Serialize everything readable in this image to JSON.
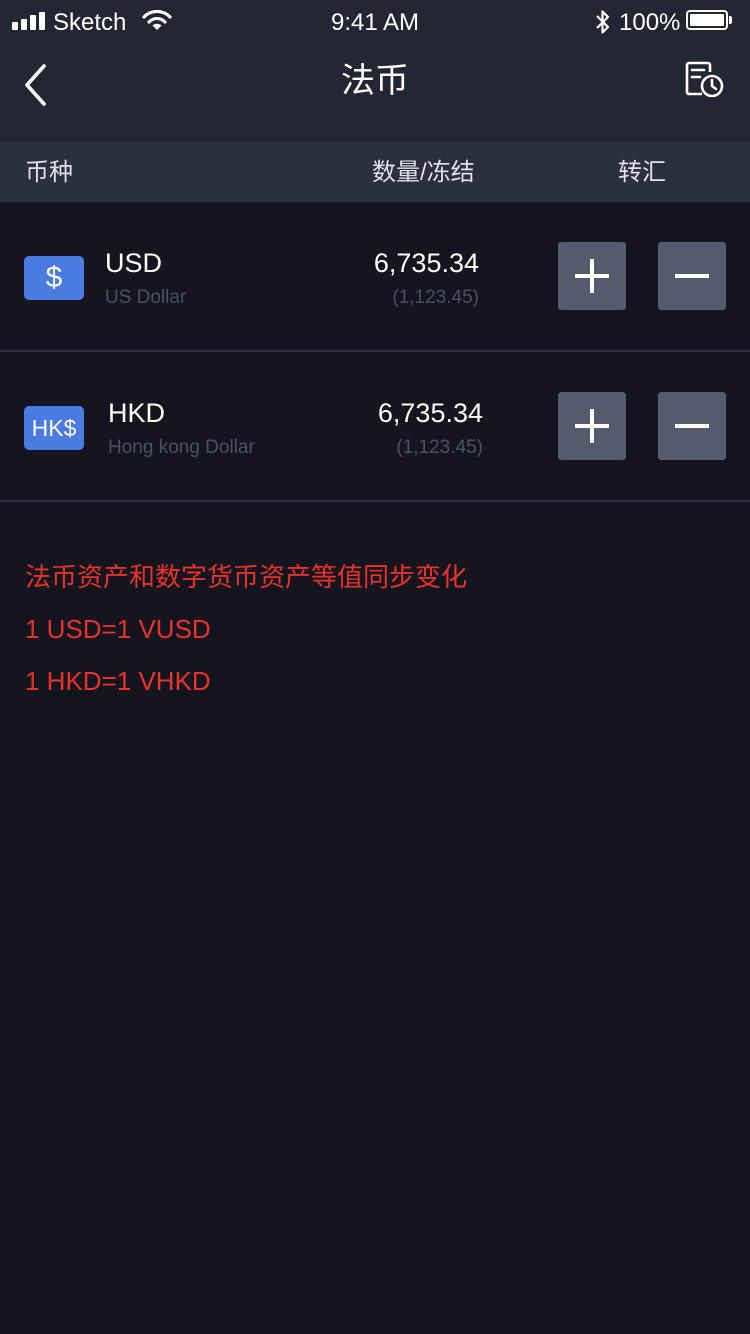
{
  "status_bar": {
    "carrier": "Sketch",
    "time": "9:41 AM",
    "battery": "100%",
    "icons": [
      "signal-icon",
      "wifi-icon",
      "bluetooth-icon",
      "battery-icon"
    ]
  },
  "nav": {
    "title": "法币",
    "back_icon": "chevron-left-icon",
    "history_icon": "document-clock-icon"
  },
  "table": {
    "headers": {
      "currency": "币种",
      "amount": "数量/冻结",
      "transfer": "转汇"
    },
    "rows": [
      {
        "icon_symbol": "$",
        "code": "USD",
        "name": "US Dollar",
        "amount": "6,735.34",
        "frozen": "(1,123.45)"
      },
      {
        "icon_symbol": "HK$",
        "code": "HKD",
        "name": "Hong kong Dollar",
        "amount": "6,735.34",
        "frozen": "(1,123.45)"
      }
    ]
  },
  "notes": [
    "法币资产和数字货币资产等值同步变化",
    "1 USD=1 VUSD",
    "1 HKD=1 VHKD"
  ],
  "colors": {
    "background": "#14151e",
    "header_bg": "#222733",
    "table_header_bg": "#2b303d",
    "accent_blue": "#4a7be3",
    "button_bg": "#545b6d",
    "note_red": "#e8332a"
  }
}
